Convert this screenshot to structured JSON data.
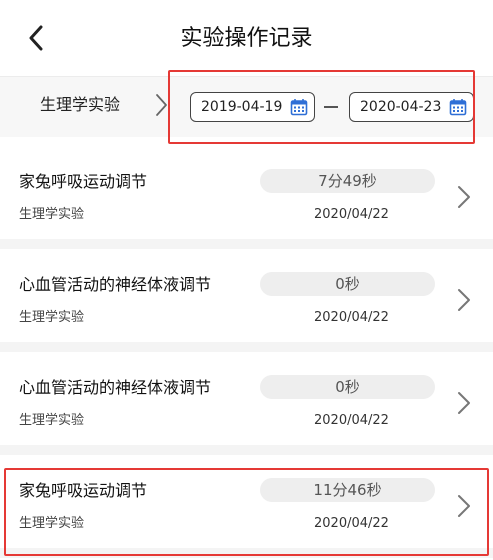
{
  "header": {
    "title": "实验操作记录",
    "back_icon": "chevron-left-icon"
  },
  "filter": {
    "category": "生理学实验",
    "date_start": "2019-04-19",
    "date_end": "2020-04-23",
    "calendar_icon": "calendar-icon",
    "calendar_color": "#2f6fd6"
  },
  "records": [
    {
      "title": "家兔呼吸运动调节",
      "subject": "生理学实验",
      "duration": "7分49秒",
      "date": "2020/04/22"
    },
    {
      "title": "心血管活动的神经体液调节",
      "subject": "生理学实验",
      "duration": "0秒",
      "date": "2020/04/22"
    },
    {
      "title": "心血管活动的神经体液调节",
      "subject": "生理学实验",
      "duration": "0秒",
      "date": "2020/04/22"
    },
    {
      "title": "家兔呼吸运动调节",
      "subject": "生理学实验",
      "duration": "11分46秒",
      "date": "2020/04/22"
    }
  ],
  "colors": {
    "highlight": "#e53935",
    "pill_bg": "#eeeeee"
  }
}
